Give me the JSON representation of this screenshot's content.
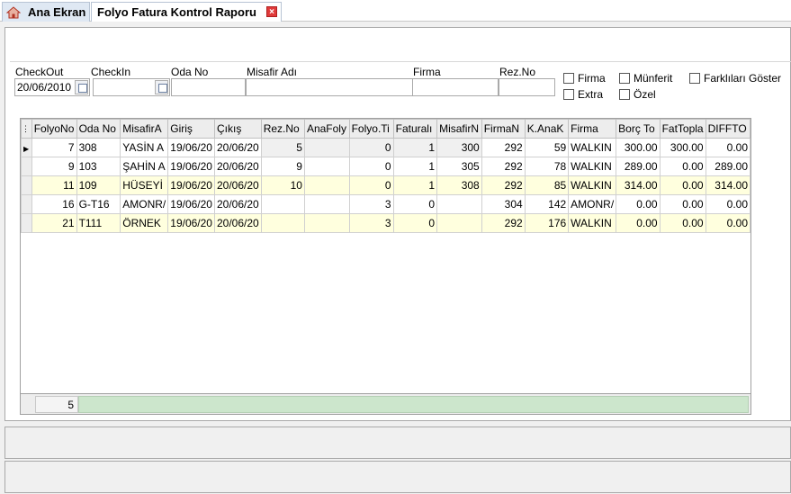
{
  "tabs": [
    {
      "label": "Ana Ekran"
    },
    {
      "label": "Folyo Fatura Kontrol Raporu"
    }
  ],
  "filters": {
    "checkout_label": "CheckOut",
    "checkout_value": "20/06/2010",
    "checkin_label": "CheckIn",
    "checkin_value": "",
    "odano_label": "Oda No",
    "misafir_label": "Misafir Adı",
    "firma_label": "Firma",
    "rezno_label": "Rez.No"
  },
  "checkboxes": {
    "firma": "Firma",
    "extra": "Extra",
    "munferit": "Münferit",
    "ozel": "Özel",
    "farkli": "Farklıları Göster"
  },
  "grid": {
    "columns": [
      "FolyoNo",
      "Oda No",
      "MisafirA",
      "Giriş",
      "Çıkış",
      "Rez.No",
      "AnaFoly",
      "Folyo.Ti",
      "Faturalı",
      "MisafirN",
      "FirmaN",
      "K.AnaK",
      "Firma",
      "Borç To",
      "FatTopla",
      "DIFFTO"
    ],
    "rows": [
      [
        "7",
        "308",
        "YASİN A",
        "19/06/20",
        "20/06/20",
        "5",
        "",
        "0",
        "1",
        "300",
        "292",
        "59",
        "WALKIN",
        "300.00",
        "300.00",
        "0.00"
      ],
      [
        "9",
        "103",
        "ŞAHİN A",
        "19/06/20",
        "20/06/20",
        "9",
        "",
        "0",
        "1",
        "305",
        "292",
        "78",
        "WALKIN",
        "289.00",
        "0.00",
        "289.00"
      ],
      [
        "11",
        "109",
        "HÜSEYİ",
        "19/06/20",
        "20/06/20",
        "10",
        "",
        "0",
        "1",
        "308",
        "292",
        "85",
        "WALKIN",
        "314.00",
        "0.00",
        "314.00"
      ],
      [
        "16",
        "G-T16",
        "AMONR/",
        "19/06/20",
        "20/06/20",
        "",
        "",
        "3",
        "0",
        "",
        "304",
        "142",
        "AMONR/",
        "0.00",
        "0.00",
        "0.00"
      ],
      [
        "21",
        "T111",
        "ÖRNEK",
        "19/06/20",
        "20/06/20",
        "",
        "",
        "3",
        "0",
        "",
        "292",
        "176",
        "WALKIN",
        "0.00",
        "0.00",
        "0.00"
      ]
    ],
    "footer_count": "5"
  },
  "colors": {
    "alt_row": "#ffffde",
    "footer_bar": "#cce6cc",
    "close_button": "#e03a3a"
  }
}
